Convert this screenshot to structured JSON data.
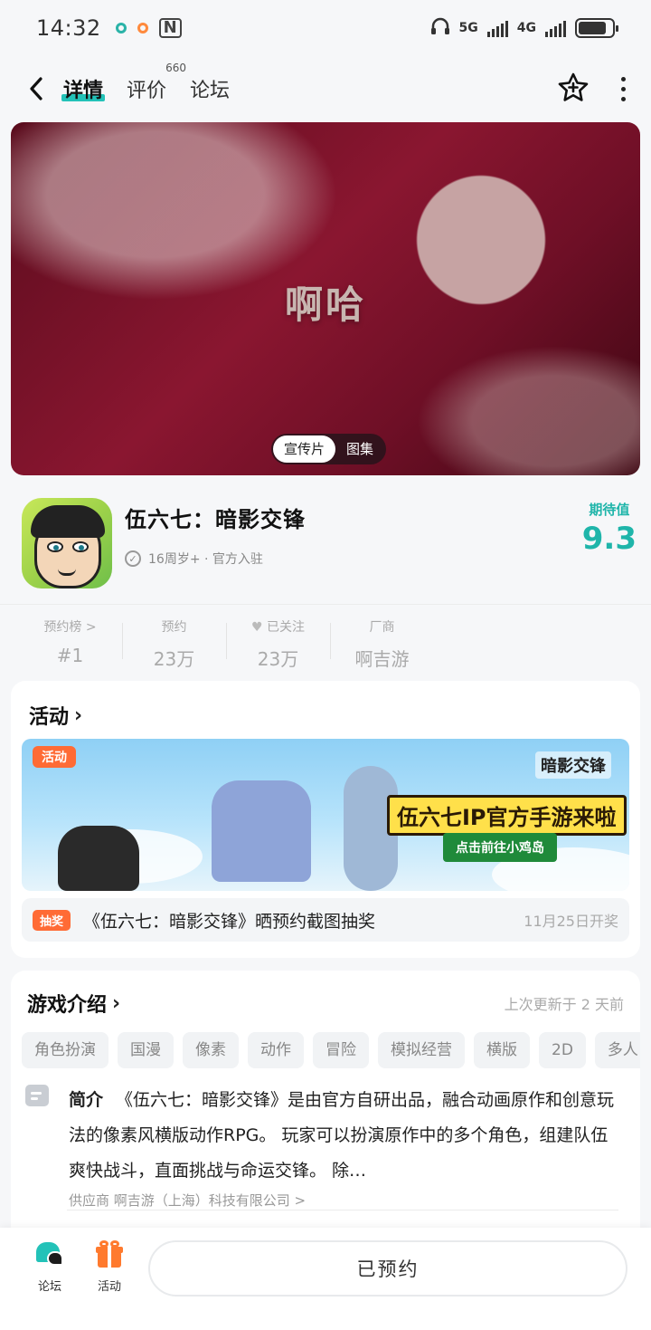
{
  "status_bar": {
    "time": "14:32",
    "net1": "5G",
    "net2": "4G"
  },
  "nav": {
    "tabs": [
      {
        "label": "详情",
        "active": true
      },
      {
        "label": "评价",
        "badge": "660"
      },
      {
        "label": "论坛"
      }
    ]
  },
  "banner": {
    "text": "啊哈",
    "toggle": [
      "宣传片",
      "图集"
    ]
  },
  "game": {
    "title": "伍六七：暗影交锋",
    "meta": "16周岁+ · 官方入驻",
    "score_label": "期待值",
    "score_value": "9.3"
  },
  "stats": [
    {
      "label": "预约榜 >",
      "value": "#1"
    },
    {
      "label": "预约",
      "value": "23万"
    },
    {
      "label": "已关注",
      "value": "23万"
    },
    {
      "label": "厂商",
      "value": "啊吉游"
    }
  ],
  "activity": {
    "title": "活动",
    "banner_tag": "活动",
    "banner_logo": "暗影交锋",
    "banner_headline": "伍六七IP官方手游来啦",
    "banner_cta": "点击前往小鸡岛",
    "lottery_tag": "抽奖",
    "lottery_text": "《伍六七：暗影交锋》晒预约截图抽奖",
    "lottery_date": "11月25日开奖"
  },
  "intro": {
    "title": "游戏介绍",
    "update": "上次更新于 2 天前",
    "tags": [
      "角色扮演",
      "国漫",
      "像素",
      "动作",
      "冒险",
      "模拟经营",
      "横版",
      "2D",
      "多人"
    ],
    "label": "简介",
    "text": "《伍六七：暗影交锋》是由官方自研出品，融合动画原作和创意玩法的像素风横版动作RPG。 玩家可以扮演原作中的多个角色，组建队伍爽快战斗，直面挑战与命运交锋。 除…",
    "supplier": "供应商 啊吉游（上海）科技有限公司 >"
  },
  "bottom": {
    "forum": "论坛",
    "activity": "活动",
    "reserve": "已预约"
  },
  "colors": {
    "accent": "#23c2b8",
    "orange": "#ff6b35"
  }
}
